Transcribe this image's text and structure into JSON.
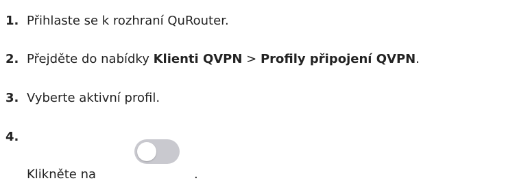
{
  "steps": [
    {
      "number": "1.",
      "text": "Přihlaste se k rozhraní QuRouter."
    },
    {
      "number": "2.",
      "prefix": "Přejděte do nabídky ",
      "menu1": "Klienti QVPN",
      "separator": " > ",
      "menu2": "Profily připojení QVPN",
      "suffix": "."
    },
    {
      "number": "3.",
      "text": "Vyberte aktivní profil."
    },
    {
      "number": "4.",
      "text": "Klikněte na",
      "suffix": ".",
      "toggle_state": "off"
    }
  ],
  "colors": {
    "text": "#222222",
    "toggle_track": "#c9c9cf",
    "toggle_knob": "#ffffff"
  }
}
